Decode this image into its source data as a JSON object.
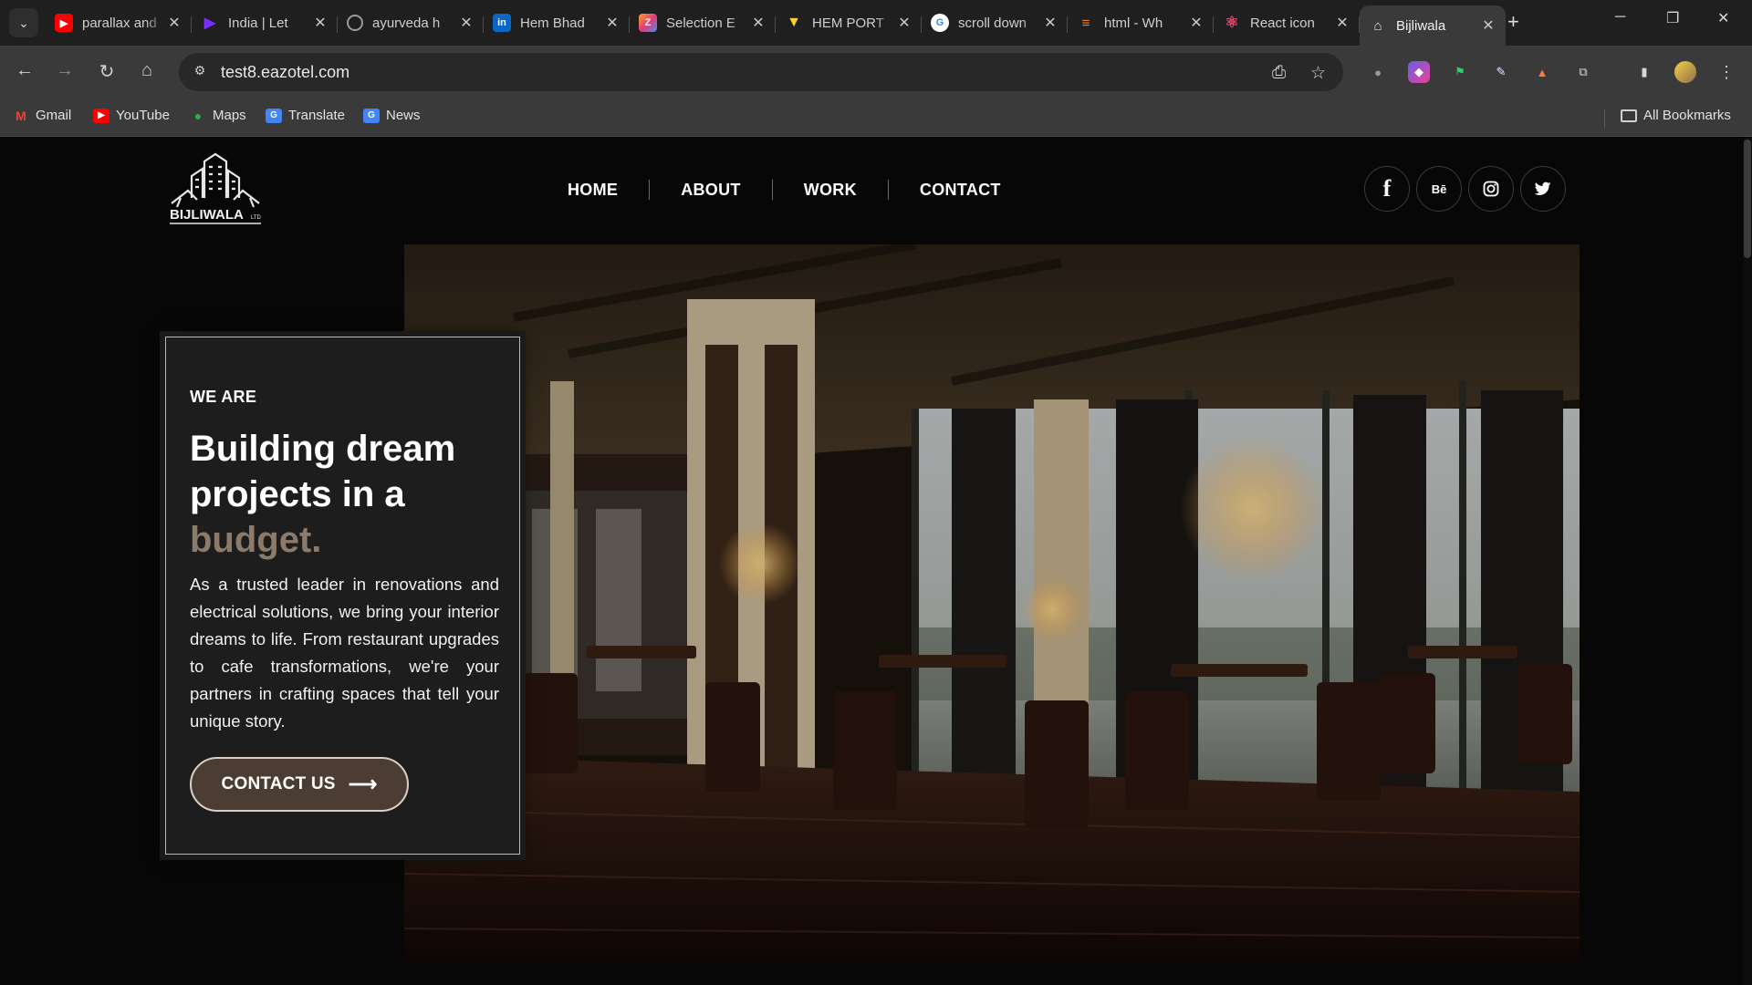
{
  "browser": {
    "tabs": [
      {
        "title": "parallax and",
        "favicon": "youtube-icon",
        "color": "#ff0000"
      },
      {
        "title": "India | Let",
        "favicon": "play-icon",
        "color": "#7b2cff"
      },
      {
        "title": "ayurveda h",
        "favicon": "globe-icon",
        "color": "#9a9a9a"
      },
      {
        "title": "Hem Bhad",
        "favicon": "linkedin-icon",
        "color": "#0a66c2"
      },
      {
        "title": "Selection E",
        "favicon": "tool-icon",
        "color": "#e23b7a"
      },
      {
        "title": "HEM PORT",
        "favicon": "vite-icon",
        "color": "#a855f7"
      },
      {
        "title": "scroll down",
        "favicon": "google-icon",
        "color": "#4285f4"
      },
      {
        "title": "html - Wh",
        "favicon": "stackoverflow-icon",
        "color": "#f48024"
      },
      {
        "title": "React icon",
        "favicon": "react-icon",
        "color": "#e34c6e"
      },
      {
        "title": "Bijliwala",
        "favicon": "bijliwala-icon",
        "color": "#cfcfcf",
        "active": true
      }
    ],
    "url": "test8.eazotel.com",
    "bookmarks": [
      {
        "label": "Gmail",
        "icon": "gmail-icon",
        "color": "#ea4335"
      },
      {
        "label": "YouTube",
        "icon": "youtube-icon",
        "color": "#ff0000"
      },
      {
        "label": "Maps",
        "icon": "maps-icon",
        "color": "#34a853"
      },
      {
        "label": "Translate",
        "icon": "translate-icon",
        "color": "#4285f4"
      },
      {
        "label": "News",
        "icon": "news-icon",
        "color": "#4285f4"
      }
    ],
    "all_bookmarks": "All Bookmarks"
  },
  "site": {
    "logo_text": "BIJLIWALA",
    "logo_suffix": "LTD",
    "nav": [
      "HOME",
      "ABOUT",
      "WORK",
      "CONTACT"
    ],
    "socials": [
      {
        "name": "facebook-icon",
        "glyph": "f"
      },
      {
        "name": "behance-icon",
        "glyph": "Bē"
      },
      {
        "name": "instagram-icon",
        "glyph": ""
      },
      {
        "name": "twitter-icon",
        "glyph": ""
      }
    ],
    "hero": {
      "eyebrow": "WE ARE",
      "headline_line1": "Building dream",
      "headline_line2": "projects in a",
      "headline_accent": "budget.",
      "description": "As a trusted leader in renovations and electrical solutions, we bring your interior dreams to life. From restaurant upgrades to cafe transformations, we're your partners in crafting spaces that tell your unique story.",
      "cta_label": "CONTACT US",
      "accent_color": "#8c7a6a"
    }
  }
}
